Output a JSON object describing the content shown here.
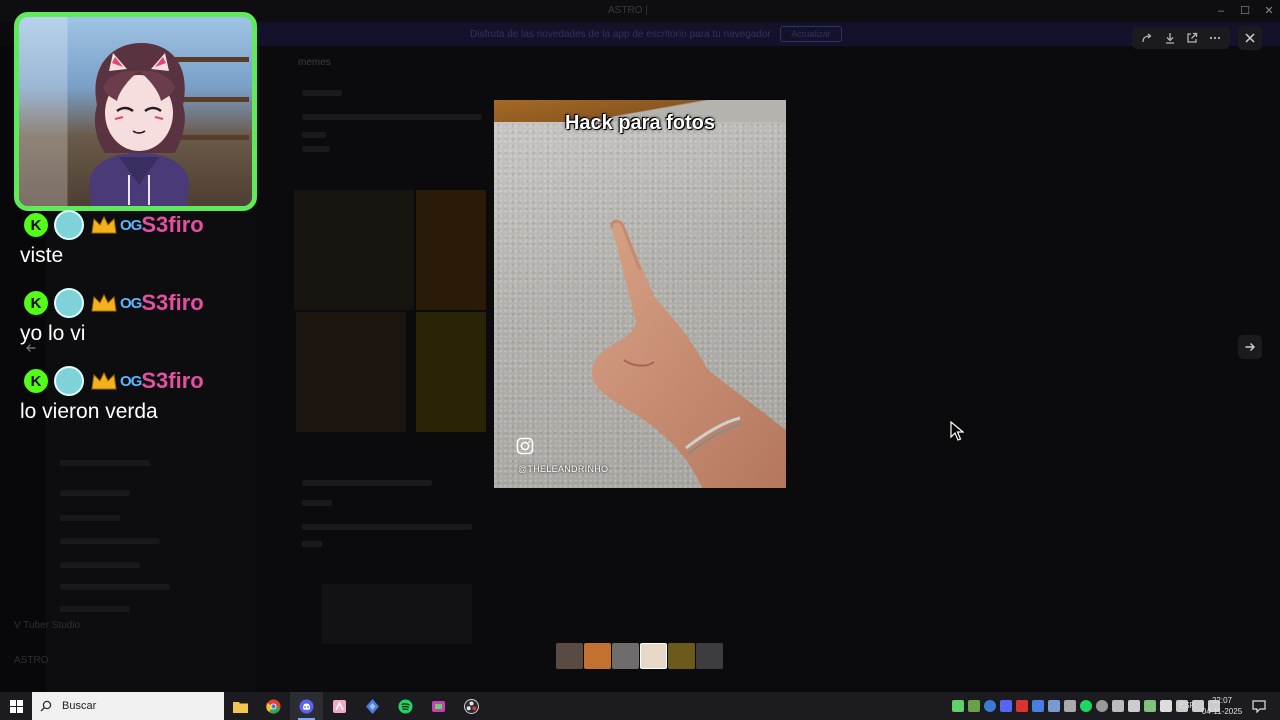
{
  "background_app": {
    "window_title": "ASTRO | ",
    "banner_text": "Disfruta de las novedades de la app de escritorio para tu navegador",
    "banner_button": "Actualizar",
    "channel_name": "memes",
    "user_name": "ASTRO",
    "vbox_label": "V Tuber Studio"
  },
  "viewer": {
    "tools": [
      "forward-icon",
      "download-icon",
      "open-external-icon",
      "more-icon"
    ],
    "close_icon": "close-icon",
    "next_icon": "arrow-right-icon",
    "prev_icon": "arrow-left-icon"
  },
  "video": {
    "caption": "Hack para fotos",
    "handle": "@THELEANDRINHO",
    "platform_icon": "instagram-icon"
  },
  "thumbnails": [
    {
      "color": "#5a4a44"
    },
    {
      "color": "#c2722e"
    },
    {
      "color": "#6e6d6b"
    },
    {
      "color": "#e8d8c8"
    },
    {
      "color": "#6b5a1a"
    },
    {
      "color": "#3d3d40"
    }
  ],
  "chat": {
    "messages": [
      {
        "user": "S3firo",
        "text": "viste"
      },
      {
        "user": "S3firo",
        "text": "yo lo vi"
      },
      {
        "user": "S3firo",
        "text": "lo vieron verda"
      }
    ],
    "badge_letter": "K",
    "badge_og": "OG",
    "username_color": "#e44fa0",
    "cam_border_color": "#5fea5a"
  },
  "taskbar": {
    "search_placeholder": "Buscar",
    "apps": [
      {
        "name": "file-explorer",
        "color": "#f3c74f"
      },
      {
        "name": "chrome",
        "color": "#e34133"
      },
      {
        "name": "discord",
        "color": "#5865f2",
        "active": true
      },
      {
        "name": "vtube-studio",
        "color": "#f2a8c8"
      },
      {
        "name": "app-blue",
        "color": "#4a7de0"
      },
      {
        "name": "spotify",
        "color": "#1ed760"
      },
      {
        "name": "app-green",
        "color": "#6ad06a"
      },
      {
        "name": "obs",
        "color": "#d83a3a"
      }
    ],
    "language": "ESP",
    "time": "22:07",
    "date": "04-11-2025"
  }
}
